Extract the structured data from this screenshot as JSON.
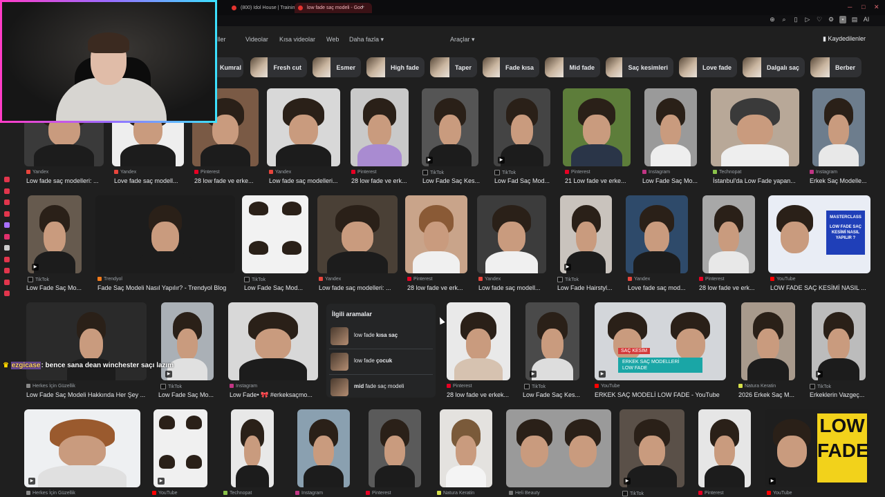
{
  "browser": {
    "tabs": [
      {
        "label": "(800) Idol House | Trainin"
      },
      {
        "label": "low fade saç modeli - Goo"
      }
    ],
    "new_tab": "+",
    "toolbar_icons": [
      "zoom-icon",
      "search-icon",
      "bookmark-icon",
      "play-icon",
      "heart-icon",
      "extensions-icon",
      "ai-icon"
    ],
    "ai_label": "AI"
  },
  "search": {
    "tabs": [
      "Görseller",
      "Videolar",
      "Kısa videolar",
      "Web",
      "Daha fazla ▾"
    ],
    "tools": "Araçlar ▾",
    "saved": "Kaydedilenler",
    "chips": [
      "Kumral",
      "Fresh cut",
      "Esmer",
      "High fade",
      "Taper",
      "Fade kısa",
      "Mid fade",
      "Saç kesimleri",
      "Love fade",
      "Dalgalı saç",
      "Berber"
    ]
  },
  "results": {
    "row1": [
      {
        "source": "Yandex",
        "title": "Low fade saç modelleri: ...",
        "color": "#e8453c"
      },
      {
        "source": "Yandex",
        "title": "Love fade saç modell...",
        "color": "#e8453c"
      },
      {
        "source": "Pinterest",
        "title": "28 low fade ve erke...",
        "color": "#e60023"
      },
      {
        "source": "Yandex",
        "title": "Low fade saç modelleri...",
        "color": "#e8453c"
      },
      {
        "source": "Pinterest",
        "title": "28 low fade ve erk...",
        "color": "#e60023"
      },
      {
        "source": "TikTok",
        "title": "Low Fade Saç Kes...",
        "color": "#333"
      },
      {
        "source": "TikTok",
        "title": "Low Fad Saç Mod...",
        "color": "#333"
      },
      {
        "source": "Pinterest",
        "title": "21 Low fade ve erke...",
        "color": "#e60023"
      },
      {
        "source": "Instagram",
        "title": "Low Fade Saç Mo...",
        "color": "#c13584"
      },
      {
        "source": "Technopat",
        "title": "İstanbul'da Low Fade yapan...",
        "color": "#8bc34a"
      },
      {
        "source": "Instagram",
        "title": "Erkek Saç Modelle...",
        "color": "#c13584"
      }
    ],
    "row2": [
      {
        "source": "TikTok",
        "title": "Low Fade Saç Mo...",
        "color": "#333"
      },
      {
        "source": "Trendyol",
        "title": "Fade Saç Modeli Nasıl Yapılır? - Trendyol Blog",
        "color": "#f27a1a"
      },
      {
        "source": "TikTok",
        "title": "Low Fade Saç Mod...",
        "color": "#333"
      },
      {
        "source": "Yandex",
        "title": "Low fade saç modelleri: ...",
        "color": "#e8453c"
      },
      {
        "source": "Pinterest",
        "title": "28 low fade ve erk...",
        "color": "#e60023"
      },
      {
        "source": "Yandex",
        "title": "Low fade saç modell...",
        "color": "#e8453c"
      },
      {
        "source": "TikTok",
        "title": "Low Fade Hairstyl...",
        "color": "#333"
      },
      {
        "source": "Yandex",
        "title": "Love fade saç mod...",
        "color": "#e8453c"
      },
      {
        "source": "Pinterest",
        "title": "28 low fade ve erk...",
        "color": "#e60023"
      },
      {
        "source": "YouTube",
        "title": "LOW FADE SAÇ KESİMİ NASIL ...",
        "color": "#ff0000"
      }
    ],
    "row3": [
      {
        "source": "Herkes İçin Güzellik",
        "title": "Low Fade Saç Modeli Hakkında Her Şey ...",
        "color": "#888"
      },
      {
        "source": "TikTok",
        "title": "Low Fade Saç Mo...",
        "color": "#333"
      },
      {
        "source": "Instagram",
        "title": "Low Fade• 🎀 #erkeksaçmo...",
        "color": "#c13584"
      },
      {
        "source": "Pinterest",
        "title": "28 low fade ve erkek...",
        "color": "#e60023"
      },
      {
        "source": "TikTok",
        "title": "Low Fade Saç Kes...",
        "color": "#333"
      },
      {
        "source": "YouTube",
        "title": "ERKEK SAÇ MODELİ LOW FADE - YouTube",
        "color": "#ff0000"
      },
      {
        "source": "Natura Keratin",
        "title": "2026 Erkek Saç M...",
        "color": "#d6e04a"
      },
      {
        "source": "TikTok",
        "title": "Erkeklerin Vazgeç...",
        "color": "#333"
      }
    ],
    "row4": [
      {
        "source": "Herkes İçin Güzellik",
        "color": "#888"
      },
      {
        "source": "YouTube",
        "color": "#ff0000"
      },
      {
        "source": "Technopat",
        "color": "#8bc34a"
      },
      {
        "source": "Instagram",
        "color": "#c13584"
      },
      {
        "source": "Pinterest",
        "color": "#e60023"
      },
      {
        "source": "Natura Keratin",
        "color": "#d6e04a"
      },
      {
        "source": "Heli Beauty",
        "color": "#777"
      },
      {
        "source": "TikTok",
        "color": "#333"
      },
      {
        "source": "Pinterest",
        "color": "#e60023"
      },
      {
        "source": "YouTube",
        "color": "#ff0000"
      }
    ]
  },
  "related": {
    "heading": "İlgili aramalar",
    "items": [
      {
        "prefix": "low fade ",
        "bold": "kısa saç"
      },
      {
        "prefix": "low fade ",
        "bold": "çocuk"
      },
      {
        "prefix": "",
        "bold": "mid",
        "suffix": " fade saç modeli"
      }
    ]
  },
  "overlay_text": {
    "masterclass_title": "LOW FADE SAÇ KESİMİ NASIL YAPILIR ?",
    "masterclass_brand": "MASTERCLASS",
    "erkek_caption1": "SAÇ KESİM",
    "erkek_caption2": "ERKEK SAÇ MODELLERİ",
    "erkek_caption3": "LOW FADE",
    "low_fade_big1": "LOW",
    "low_fade_big2": "FADE"
  },
  "stream": {
    "chat_user": "ezgicase",
    "chat_message": ": bence sana dean winchester saçı lazım"
  }
}
